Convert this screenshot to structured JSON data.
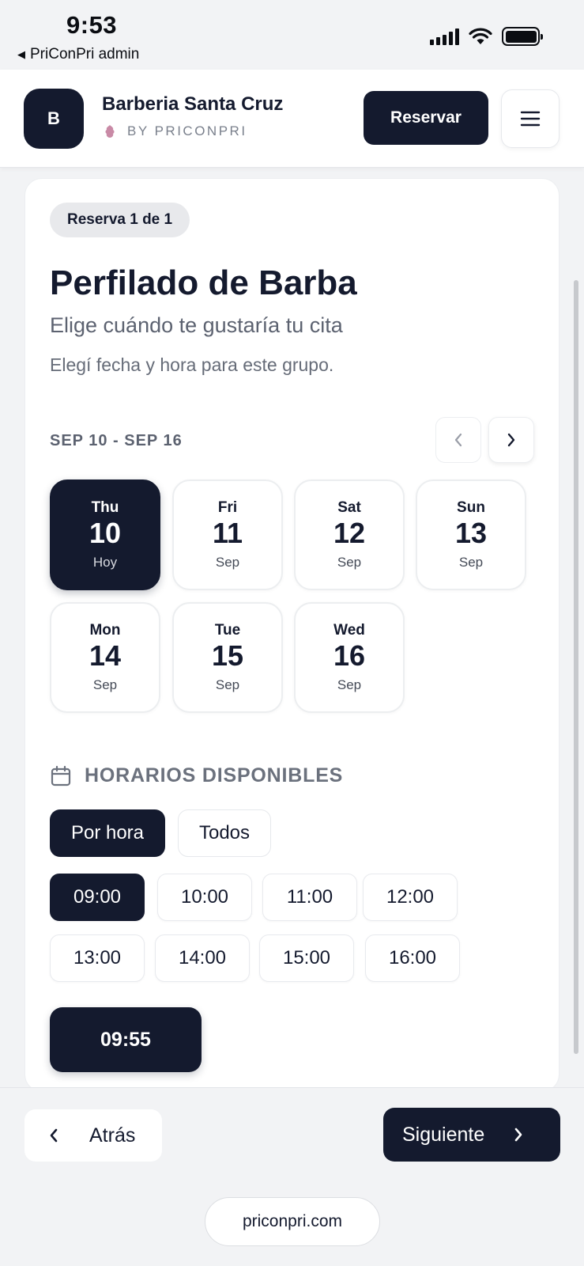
{
  "status_bar": {
    "time": "9:53",
    "back_app": "PriConPri admin",
    "icons": [
      "signal-icon",
      "wifi-icon",
      "battery-icon"
    ]
  },
  "header": {
    "logo_letter": "B",
    "business_name": "Barberia Santa Cruz",
    "byline": "BY PRICONPRI",
    "reserve_label": "Reservar",
    "menu_icon": "hamburger-menu-icon"
  },
  "card": {
    "badge": "Reserva 1 de 1",
    "title": "Perfilado de Barba",
    "subtitle": "Elige cuándo te gustaría tu cita",
    "helper": "Elegí fecha y hora para este grupo.",
    "date_range": "SEP 10 - SEP 16",
    "days": [
      {
        "weekday": "Thu",
        "day": "10",
        "sub": "Hoy",
        "selected": true
      },
      {
        "weekday": "Fri",
        "day": "11",
        "sub": "Sep",
        "selected": false
      },
      {
        "weekday": "Sat",
        "day": "12",
        "sub": "Sep",
        "selected": false
      },
      {
        "weekday": "Sun",
        "day": "13",
        "sub": "Sep",
        "selected": false
      },
      {
        "weekday": "Mon",
        "day": "14",
        "sub": "Sep",
        "selected": false
      },
      {
        "weekday": "Tue",
        "day": "15",
        "sub": "Sep",
        "selected": false
      },
      {
        "weekday": "Wed",
        "day": "16",
        "sub": "Sep",
        "selected": false
      }
    ],
    "availability_label": "HORARIOS DISPONIBLES",
    "tabs": [
      {
        "label": "Por hora",
        "active": true
      },
      {
        "label": "Todos",
        "active": false
      }
    ],
    "hour_slots": [
      {
        "label": "09:00",
        "selected": true
      },
      {
        "label": "10:00",
        "selected": false
      },
      {
        "label": "11:00",
        "selected": false
      },
      {
        "label": "12:00",
        "selected": false
      },
      {
        "label": "13:00",
        "selected": false
      },
      {
        "label": "14:00",
        "selected": false
      },
      {
        "label": "15:00",
        "selected": false
      },
      {
        "label": "16:00",
        "selected": false
      }
    ],
    "selected_time": "09:55"
  },
  "footer": {
    "back_label": "Atrás",
    "next_label": "Siguiente",
    "site": "priconpri.com"
  },
  "colors": {
    "primary": "#141a2e",
    "background": "#f2f3f5",
    "card": "#ffffff",
    "muted_text": "#5c6270"
  }
}
